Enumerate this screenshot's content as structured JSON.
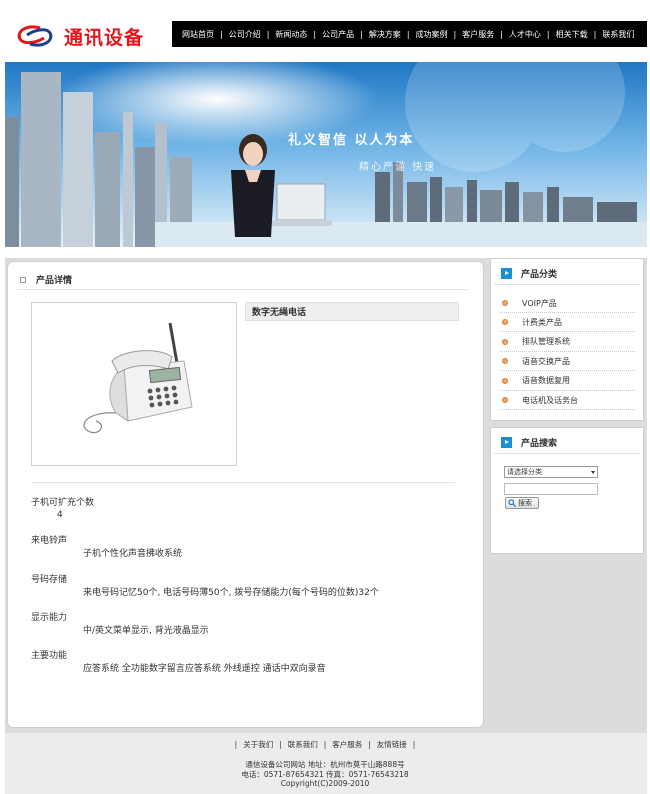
{
  "header": {
    "logo_text": "通讯设备",
    "nav": [
      "网站首页",
      "公司介绍",
      "新闻动态",
      "公司产品",
      "解决方案",
      "成功案例",
      "客户服务",
      "人才中心",
      "相关下载",
      "联系我们"
    ]
  },
  "banner": {
    "slogan": "礼义智信   以人为本",
    "subslogan": "精心严谨   快速"
  },
  "product": {
    "section_title": "产品详情",
    "name": "数字无绳电话",
    "specs": [
      {
        "label": "子机可扩充个数",
        "value": "4"
      },
      {
        "label": "来电铃声",
        "value": "子机个性化声音拂收系统"
      },
      {
        "label": "号码存储",
        "value": "来电号码记忆50个, 电话号码薄50个, 拨号存储能力(每个号码的位数)32个"
      },
      {
        "label": "显示能力",
        "value": "中/英文菜单显示, 背光液晶显示"
      },
      {
        "label": "主要功能",
        "value": "应答系统  全功能数字留言应答系统  外线遥控  通话中双向录音"
      }
    ]
  },
  "sidebar": {
    "categories_title": "产品分类",
    "categories": [
      "VOIP产品",
      "计费类产品",
      "排队管理系统",
      "语音交换产品",
      "语音数据复用",
      "电话机及话务台"
    ],
    "search_title": "产品搜索",
    "select_value": "请选择分类",
    "search_label": "搜索"
  },
  "footer": {
    "links": [
      "关于我们",
      "联系我们",
      "客户服务",
      "友情链接"
    ],
    "line1": "通信设备公司网站  地址：杭州市莫干山路888号",
    "line2": "电话：0571-87654321   传真：0571-76543218",
    "line3": "Copyright(C)2009-2010"
  },
  "colors": {
    "accent_red": "#e3161b",
    "nav_bg": "#000000",
    "side_icon": "#1b8fd6"
  }
}
